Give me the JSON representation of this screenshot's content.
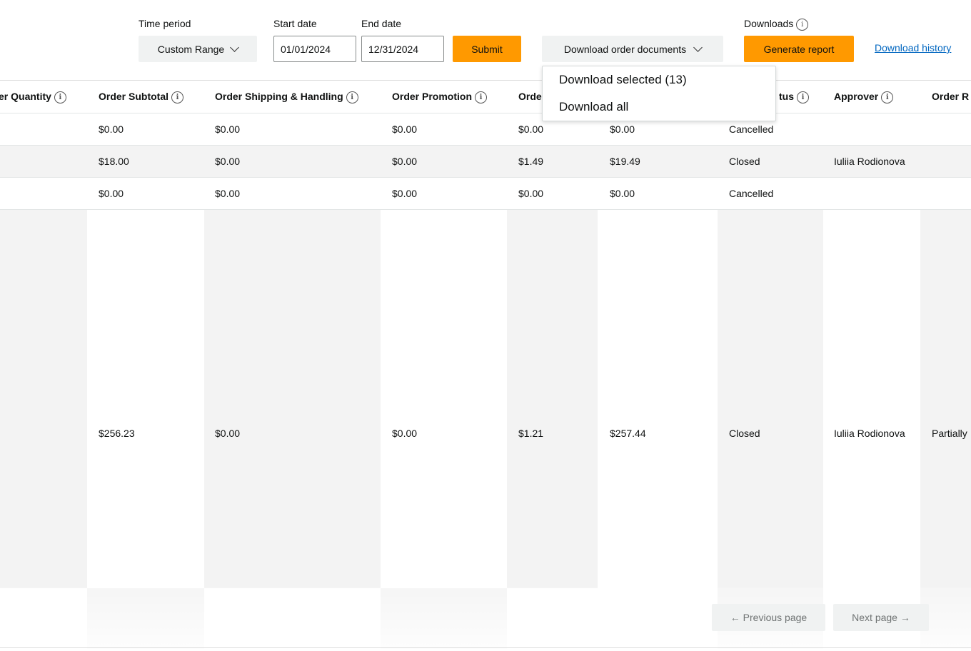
{
  "filters": {
    "time_period_label": "Time period",
    "time_period_value": "Custom Range",
    "start_date_label": "Start date",
    "start_date_value": "01/01/2024",
    "end_date_label": "End date",
    "end_date_value": "12/31/2024",
    "submit_label": "Submit"
  },
  "downloads": {
    "order_docs_label": "Download order documents",
    "downloads_label": "Downloads",
    "generate_report_label": "Generate report",
    "history_link": "Download history",
    "menu": [
      "Download selected (13)",
      "Download all"
    ]
  },
  "table": {
    "headers": {
      "quantity": "er Quantity",
      "subtotal": "Order Subtotal",
      "shipping": "Order Shipping & Handling",
      "promotion": "Order Promotion",
      "tax": "Orde",
      "status": "tus",
      "approver": "Approver",
      "receiving": "Order R"
    },
    "rows": [
      {
        "subtotal": "$0.00",
        "shipping": "$0.00",
        "promotion": "$0.00",
        "tax": "$0.00",
        "net": "$0.00",
        "status": "Cancelled",
        "approver": "",
        "receiving": ""
      },
      {
        "subtotal": "$18.00",
        "shipping": "$0.00",
        "promotion": "$0.00",
        "tax": "$1.49",
        "net": "$19.49",
        "status": "Closed",
        "approver": "Iuliia Rodionova",
        "receiving": ""
      },
      {
        "subtotal": "$0.00",
        "shipping": "$0.00",
        "promotion": "$0.00",
        "tax": "$0.00",
        "net": "$0.00",
        "status": "Cancelled",
        "approver": "",
        "receiving": ""
      },
      {
        "subtotal": "$256.23",
        "shipping": "$0.00",
        "promotion": "$0.00",
        "tax": "$1.21",
        "net": "$257.44",
        "status": "Closed",
        "approver": "Iuliia Rodionova",
        "receiving": "Partially"
      }
    ]
  },
  "pagination": {
    "previous_label": "← Previous page",
    "next_label": "Next page →"
  },
  "colors": {
    "accent": "#ff9900",
    "link": "#0066c0",
    "shaded_column": "#f3f3f3"
  }
}
